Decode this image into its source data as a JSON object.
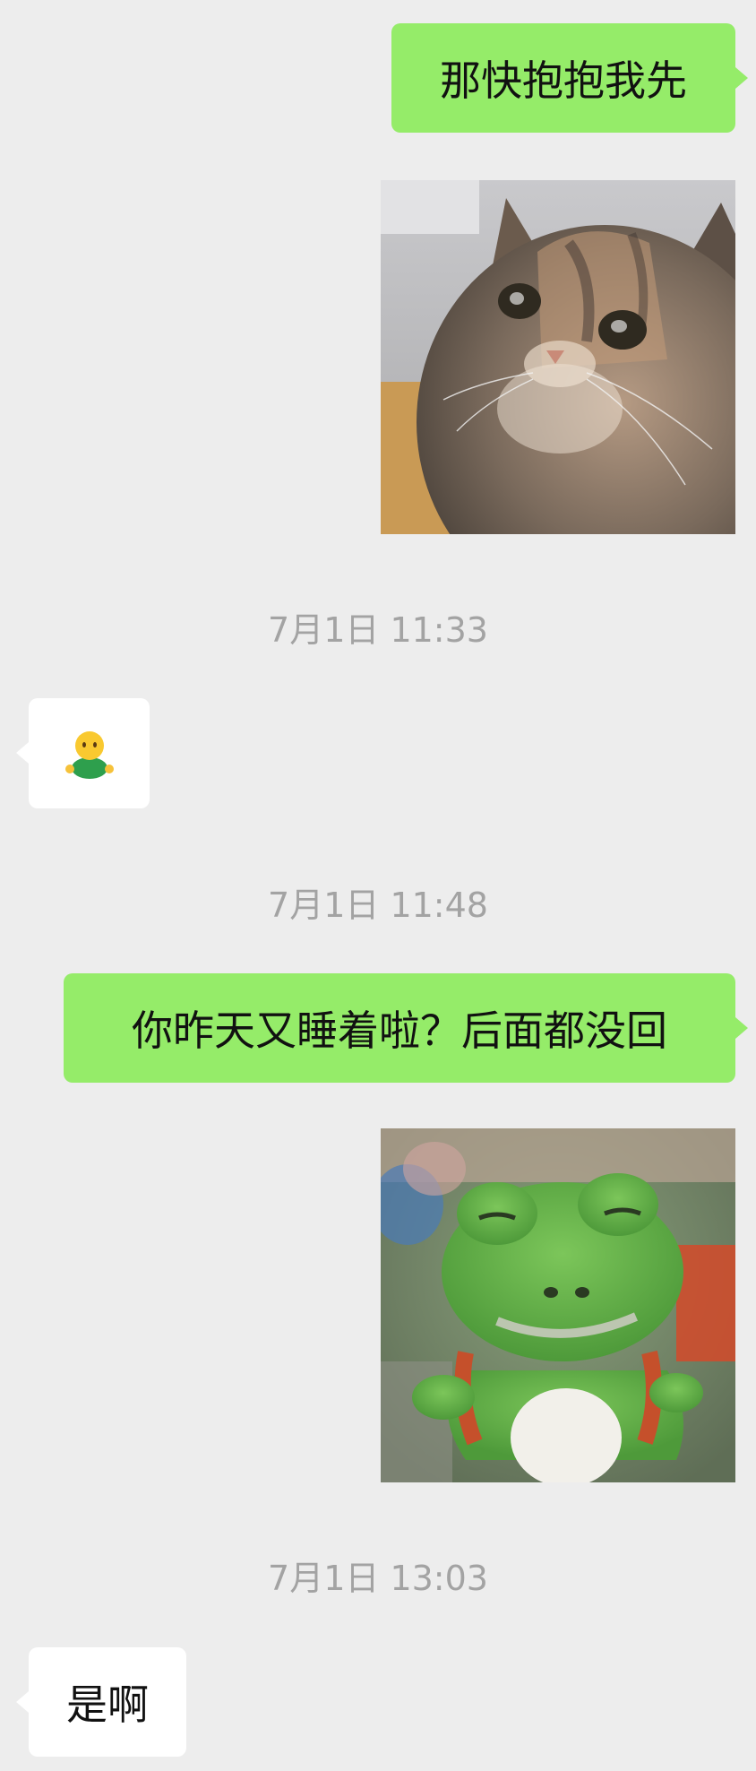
{
  "messages": {
    "m1": {
      "sender": "me",
      "text": "那快抱抱我先"
    },
    "m2": {
      "sender": "me",
      "image": "cat-photo"
    },
    "t1": {
      "timestamp": "7月1日 11:33"
    },
    "m3": {
      "sender": "them",
      "emoji": "person-shrugging-emoji"
    },
    "t2": {
      "timestamp": "7月1日 11:48"
    },
    "m4": {
      "sender": "me",
      "text": "你昨天又睡着啦？后面都没回"
    },
    "m5": {
      "sender": "me",
      "image": "green-plush-crocodile-photo"
    },
    "t3": {
      "timestamp": "7月1日 13:03"
    },
    "m6": {
      "sender": "them",
      "text": "是啊"
    }
  },
  "colors": {
    "background": "#ededed",
    "outgoing_bubble": "#95ec69",
    "incoming_bubble": "#ffffff",
    "timestamp": "#a3a3a3"
  }
}
